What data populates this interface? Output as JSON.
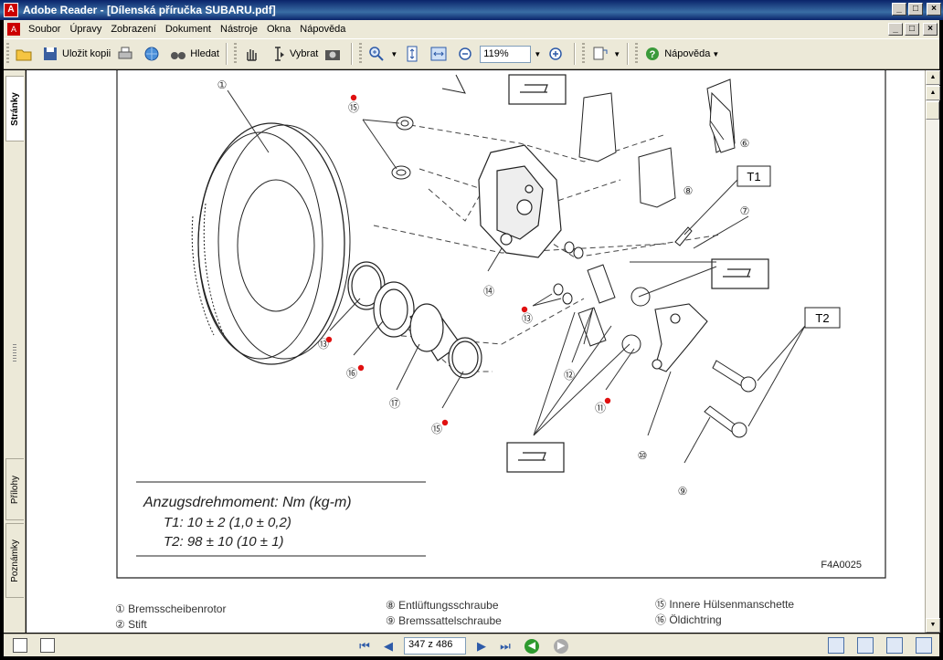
{
  "window": {
    "title": "Adobe Reader - [Dílenská příručka SUBARU.pdf]",
    "app_icon": "adobe-reader-icon",
    "minimize": "_",
    "maximize": "□",
    "close": "×"
  },
  "menubar": {
    "items": [
      "Soubor",
      "Úpravy",
      "Zobrazení",
      "Dokument",
      "Nástroje",
      "Okna",
      "Nápověda"
    ]
  },
  "toolbar": {
    "save_copy": "Uložit kopii",
    "search": "Hledat",
    "select": "Vybrat",
    "zoom_value": "119%",
    "help": "Nápověda"
  },
  "left_panel": {
    "tabs": [
      "Stránky",
      "Přílohy",
      "Poznámky"
    ]
  },
  "document": {
    "torque_title": "Anzugsdrehmoment: Nm (kg-m)",
    "torque_t1": "T1: 10 ± 2 (1,0 ± 0,2)",
    "torque_t2": "T2: 98 ± 10  (10 ± 1)",
    "figure_code": "F4A0025",
    "t1_label": "T1",
    "t2_label": "T2",
    "callouts": [
      "①",
      "⑥",
      "⑦",
      "⑧",
      "⑨",
      "⑩",
      "⑪",
      "⑫",
      "⑬",
      "⑬",
      "⑭",
      "⑮",
      "⑮",
      "⑯",
      "⑰"
    ],
    "legend": {
      "col1": [
        "① Bremsscheibenrotor",
        "② Stift"
      ],
      "col2": [
        "⑧ Entlüftungsschraube",
        "⑨ Bremssattelschraube"
      ],
      "col3": [
        "⑮ Innere Hülsenmanschette",
        "⑯ Öldichtring"
      ]
    }
  },
  "statusbar": {
    "page_indicator": "347 z 486"
  }
}
